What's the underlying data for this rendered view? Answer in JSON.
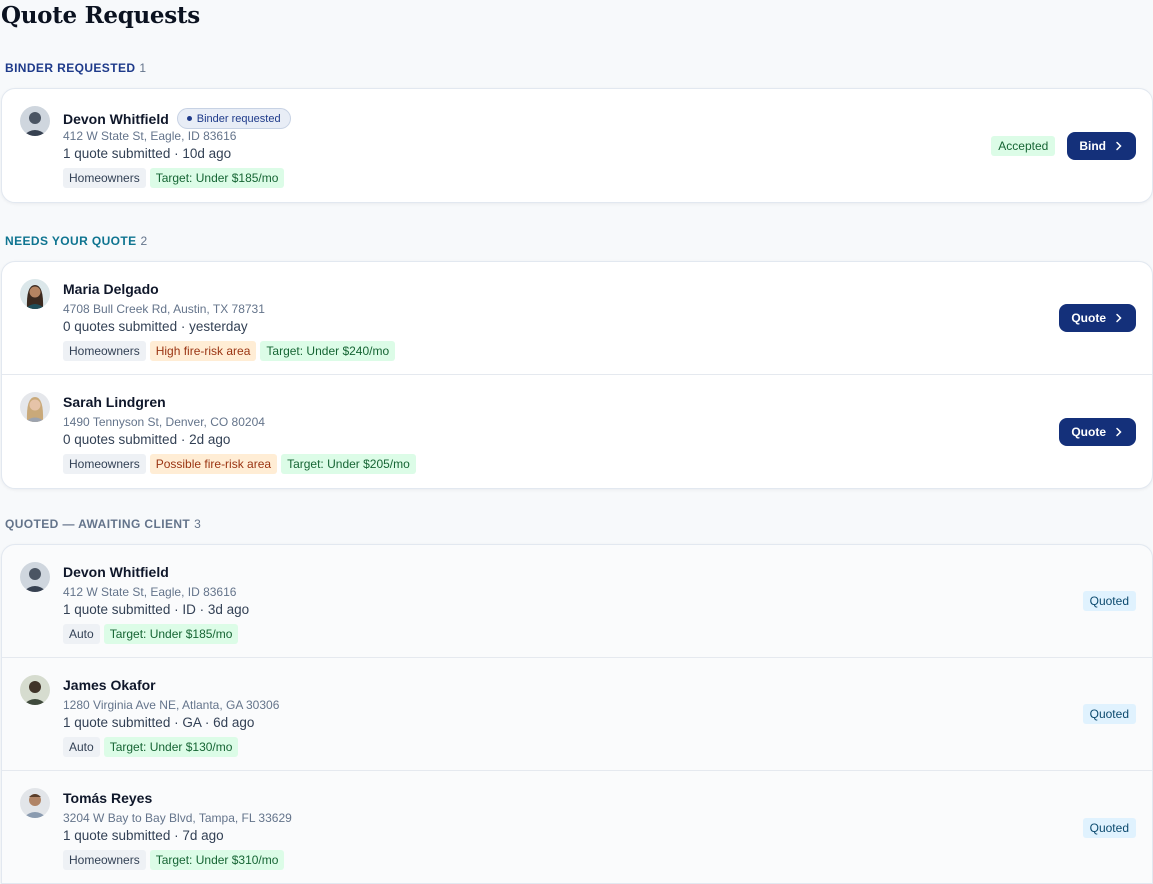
{
  "page": {
    "title": "Quote Requests"
  },
  "sections": {
    "binder": {
      "label": "BINDER REQUESTED",
      "count": "1",
      "items": [
        {
          "name": "Devon Whitfield",
          "status_pill": "Binder requested",
          "address": "412 W State St, Eagle, ID 83616",
          "meta": "1 quote submitted · 10d ago",
          "tags": [
            "Homeowners",
            "Target: Under $185/mo"
          ],
          "badge": "Accepted",
          "button": "Bind",
          "avatar_color": "#4b5563"
        }
      ]
    },
    "needs": {
      "label": "NEEDS YOUR QUOTE",
      "count": "2",
      "items": [
        {
          "name": "Maria Delgado",
          "address": "4708 Bull Creek Rd, Austin, TX 78731",
          "meta": "0 quotes submitted · yesterday",
          "tags": [
            "Homeowners",
            "High fire-risk area",
            "Target: Under $240/mo"
          ],
          "button": "Quote",
          "avatar_color": "#7c5a3b"
        },
        {
          "name": "Sarah Lindgren",
          "address": "1490 Tennyson St, Denver, CO 80204",
          "meta": "0 quotes submitted · 2d ago",
          "tags": [
            "Homeowners",
            "Possible fire-risk area",
            "Target: Under $205/mo"
          ],
          "button": "Quote",
          "avatar_color": "#c9a97a"
        }
      ]
    },
    "quoted": {
      "label": "QUOTED — AWAITING CLIENT",
      "count": "3",
      "items": [
        {
          "name": "Devon Whitfield",
          "address": "412 W State St, Eagle, ID 83616",
          "meta": "1 quote submitted · ID · 3d ago",
          "tags": [
            "Auto",
            "Target: Under $185/mo"
          ],
          "badge": "Quoted",
          "avatar_color": "#4b5563"
        },
        {
          "name": "James Okafor",
          "address": "1280 Virginia Ave NE, Atlanta, GA 30306",
          "meta": "1 quote submitted · GA · 6d ago",
          "tags": [
            "Auto",
            "Target: Under $130/mo"
          ],
          "badge": "Quoted",
          "avatar_color": "#3f4a3c"
        },
        {
          "name": "Tomás Reyes",
          "address": "3204 W Bay to Bay Blvd, Tampa, FL 33629",
          "meta": "1 quote submitted · 7d ago",
          "tags": [
            "Homeowners",
            "Target: Under $310/mo"
          ],
          "badge": "Quoted",
          "avatar_color": "#8a6a52"
        }
      ]
    }
  },
  "colors": {
    "primary_button": "#14307a",
    "accepted_bg": "#dcfce7",
    "quoted_bg": "#e0f2fe",
    "risk_tag_bg": "#ffedd5",
    "target_tag_bg": "#dcfce7"
  }
}
